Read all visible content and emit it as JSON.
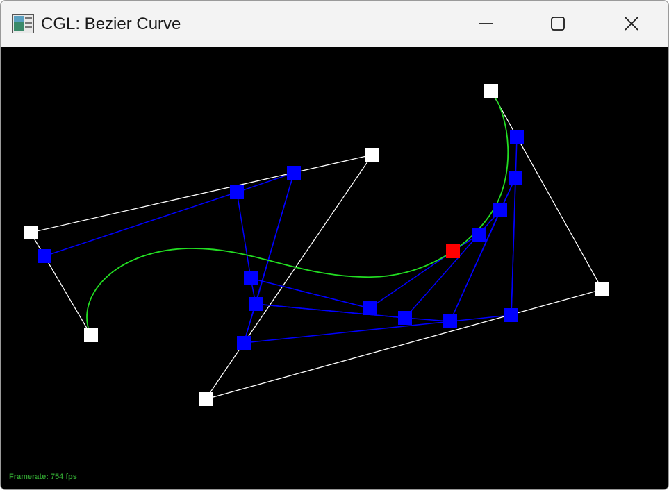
{
  "window": {
    "title": "CGL: Bezier Curve",
    "app_icon": "cgl-app-icon"
  },
  "controls": {
    "minimize_icon": "minimize-icon",
    "maximize_icon": "maximize-icon",
    "close_icon": "close-icon"
  },
  "status": {
    "framerate": "Framerate: 754 fps"
  },
  "colors": {
    "control_point": "#ffffff",
    "construction": "#0000ff",
    "curve": "#22dd22",
    "current_point": "#ff0000",
    "background": "#000000",
    "framerate_text": "#2e9a2e"
  }
}
